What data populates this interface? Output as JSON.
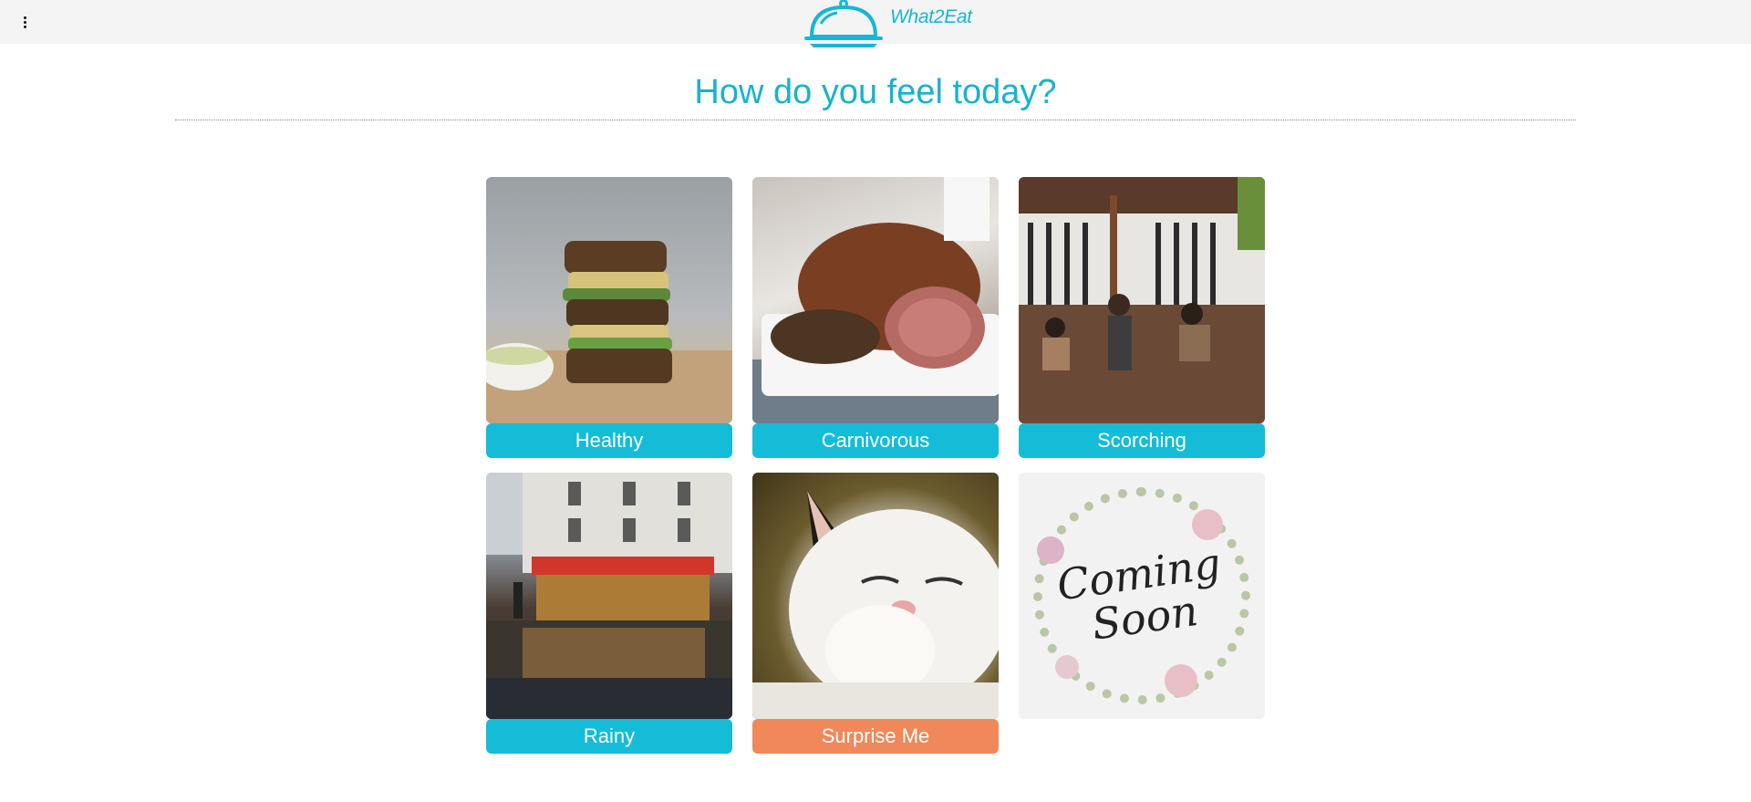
{
  "app": {
    "name": "What2Eat"
  },
  "page": {
    "headline": "How do you feel today?"
  },
  "colors": {
    "accent": "#15bcd8",
    "accent_alt": "#f0885a",
    "topbar": "#f4f4f4"
  },
  "icons": {
    "menu": "more-vert-icon",
    "logo": "cloche-icon"
  },
  "moods": [
    {
      "label": "Healthy",
      "image": "stacked multigrain sandwich with hummus and sprouts"
    },
    {
      "label": "Carnivorous",
      "image": "sliced roast beef on a serving plate"
    },
    {
      "label": "Scorching",
      "image": "busy outdoor restaurant terrace"
    },
    {
      "label": "Rainy",
      "image": "rainy street cafe at night"
    },
    {
      "label": "Surprise Me",
      "image": "smiling white cat"
    },
    {
      "label": "",
      "image": "Coming Soon floral wreath",
      "image_text": "Coming Soon"
    }
  ]
}
